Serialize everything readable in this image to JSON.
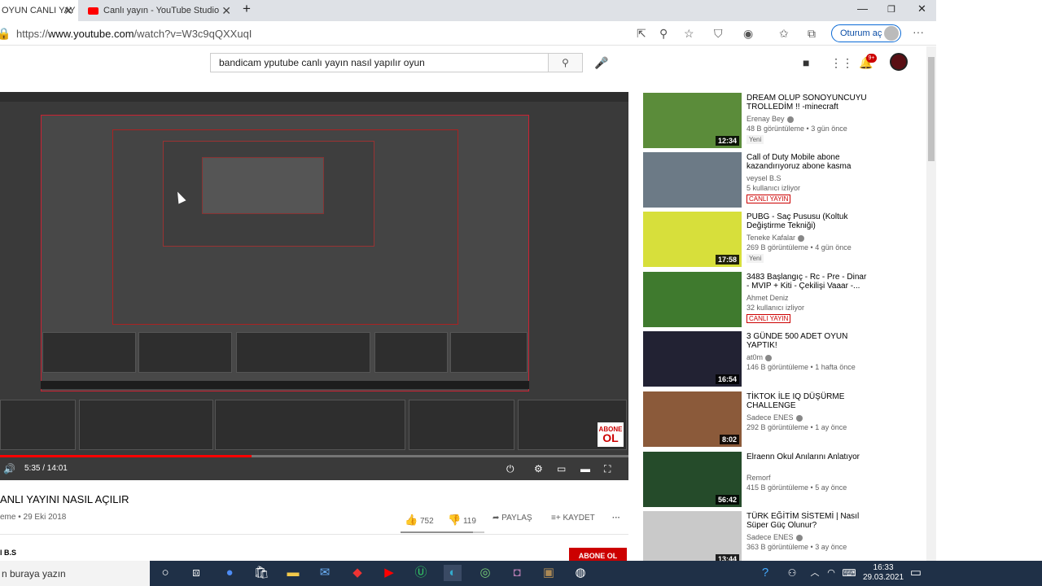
{
  "browser": {
    "tabs": [
      {
        "label": "OYUN CANLI YAY",
        "active": true
      },
      {
        "label": "Canlı yayın - YouTube Studio",
        "active": false
      }
    ],
    "new_tab": "+",
    "url_prefix": "https://",
    "url_host": "www.youtube.com",
    "url_path": "/watch?v=W3c9qQXXuqI",
    "signin_label": "Oturum aç",
    "menu": "···"
  },
  "youtube": {
    "search_value": "bandicam yputube canlı yayın nasıl yapılır oyun",
    "notif_count": "9+"
  },
  "player": {
    "time": "5:35 / 14:01",
    "progress_fraction": 0.4,
    "overlay_abone": "ABONE",
    "overlay_ol": "OL"
  },
  "video": {
    "title": "ANLI YAYINI NASIL AÇILIR",
    "meta": "eme • 29 Eki 2018",
    "likes": "752",
    "dislikes": "119",
    "share": "PAYLAŞ",
    "save": "KAYDET",
    "more": "···",
    "like_ratio": 0.86,
    "channel": "l B.S",
    "subscribe": "ABONE OL"
  },
  "recommendations": [
    {
      "title": "DREAM OLUP SONOYUNCUYU TROLLEDİM !! -minecraft",
      "channel": "Erenay Bey",
      "verified": true,
      "views": "48 B görüntüleme • 3 gün önce",
      "badge": "Yeni",
      "duration": "12:34",
      "live": false,
      "thumb_color": "#5b8c3a"
    },
    {
      "title": "Call of Duty Mobile abone kazandırıyoruz abone kasma",
      "channel": "veysel B.S",
      "verified": false,
      "views": "5 kullanıcı izliyor",
      "badge": "",
      "duration": "",
      "live": true,
      "live_label": "CANLI YAYIN",
      "thumb_color": "#6c7a86"
    },
    {
      "title": "PUBG - Saç Pususu (Koltuk Değiştirme Tekniği)",
      "channel": "Teneke Kafalar",
      "verified": true,
      "views": "269 B görüntüleme • 4 gün önce",
      "badge": "Yeni",
      "duration": "17:58",
      "live": false,
      "thumb_color": "#d7df3b"
    },
    {
      "title": "3483 Başlangıç - Rc - Pre - Dinar - MVIP + Kiti - Çekilişi Vaaar -...",
      "channel": "Ahmet Deniz",
      "verified": false,
      "views": "32 kullanıcı izliyor",
      "badge": "",
      "duration": "",
      "live": true,
      "live_label": "CANLI YAYIN",
      "thumb_color": "#3f7a2e"
    },
    {
      "title": "3 GÜNDE 500 ADET OYUN YAPTIK!",
      "channel": "at0m",
      "verified": true,
      "views": "146 B görüntüleme • 1 hafta önce",
      "badge": "",
      "duration": "16:54",
      "live": false,
      "thumb_color": "#222233"
    },
    {
      "title": "TİKTOK İLE IQ DÜŞÜRME CHALLENGE",
      "channel": "Sadece ENES",
      "verified": true,
      "views": "292 B görüntüleme • 1 ay önce",
      "badge": "",
      "duration": "8:02",
      "live": false,
      "thumb_color": "#8b5a3a"
    },
    {
      "title": "Elraenn Okul Anılarını Anlatıyor",
      "channel": "Remorf",
      "verified": false,
      "views": "415 B görüntüleme • 5 ay önce",
      "badge": "",
      "duration": "56:42",
      "live": false,
      "thumb_color": "#254b2a"
    },
    {
      "title": "TÜRK EĞİTİM SİSTEMİ | Nasıl Süper Güç Olunur?",
      "channel": "Sadece ENES",
      "verified": true,
      "views": "363 B görüntüleme • 3 ay önce",
      "badge": "",
      "duration": "13:44",
      "live": false,
      "thumb_color": "#c9c9c9"
    }
  ],
  "taskbar": {
    "search_placeholder": "n buraya yazın",
    "time": "16:33",
    "date": "29.03.2021"
  }
}
